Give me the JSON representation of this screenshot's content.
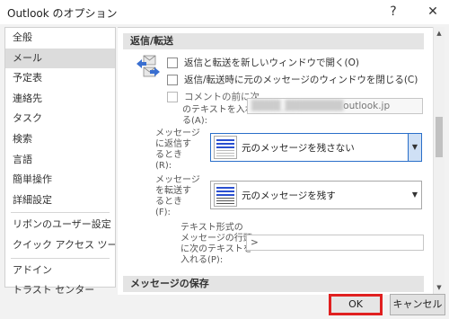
{
  "window": {
    "title": "Outlook のオプション",
    "help_glyph": "?",
    "close_glyph": "✕"
  },
  "sidebar": {
    "items": [
      {
        "label": "全般"
      },
      {
        "label": "メール",
        "selected": true
      },
      {
        "label": "予定表"
      },
      {
        "label": "連絡先"
      },
      {
        "label": "タスク"
      },
      {
        "label": "検索"
      },
      {
        "label": "言語"
      },
      {
        "label": "簡単操作"
      },
      {
        "label": "詳細設定"
      },
      {
        "label": "リボンのユーザー設定"
      },
      {
        "label": "クイック アクセス ツール バー"
      },
      {
        "label": "アドイン"
      },
      {
        "label": "トラスト センター"
      }
    ]
  },
  "reply_section": {
    "header": "返信/転送",
    "icon": "reply-forward-icon",
    "options": {
      "open_new_window": "返信と転送を新しいウィンドウで開く(O)",
      "close_original": "返信/転送時に元のメッセージのウィンドウを閉じる(C)",
      "comment_prefix_line1": "コメントの前に次",
      "comment_prefix_line2": "のテキストを入れ",
      "comment_prefix_line3": "る(A):",
      "comment_prefix_value_masked": "████_████████",
      "comment_prefix_value_suffix": "outlook.jp"
    },
    "reply_label": {
      "line1": "メッセージ",
      "line2": "に返信す",
      "line3": "るとき",
      "line4": "(R):"
    },
    "reply_dropdown": {
      "value": "元のメッセージを残さない"
    },
    "forward_label": {
      "line1": "メッセージ",
      "line2": "を転送す",
      "line3": "るとき",
      "line4": "(F):"
    },
    "forward_dropdown": {
      "value": "元のメッセージを残す"
    },
    "prefix_label": {
      "line1": "テキスト形式の",
      "line2": "メッセージの行頭",
      "line3": "に次のテキストを",
      "line4": "入れる(P):"
    },
    "prefix_value": ">"
  },
  "save_section": {
    "header": "メッセージの保存"
  },
  "footer": {
    "ok_label": "OK",
    "cancel_label": "キャンセル"
  },
  "colors": {
    "accent": "#2a6fc9",
    "highlight_border": "#e02020",
    "selected_bg": "#dcdcdc"
  }
}
